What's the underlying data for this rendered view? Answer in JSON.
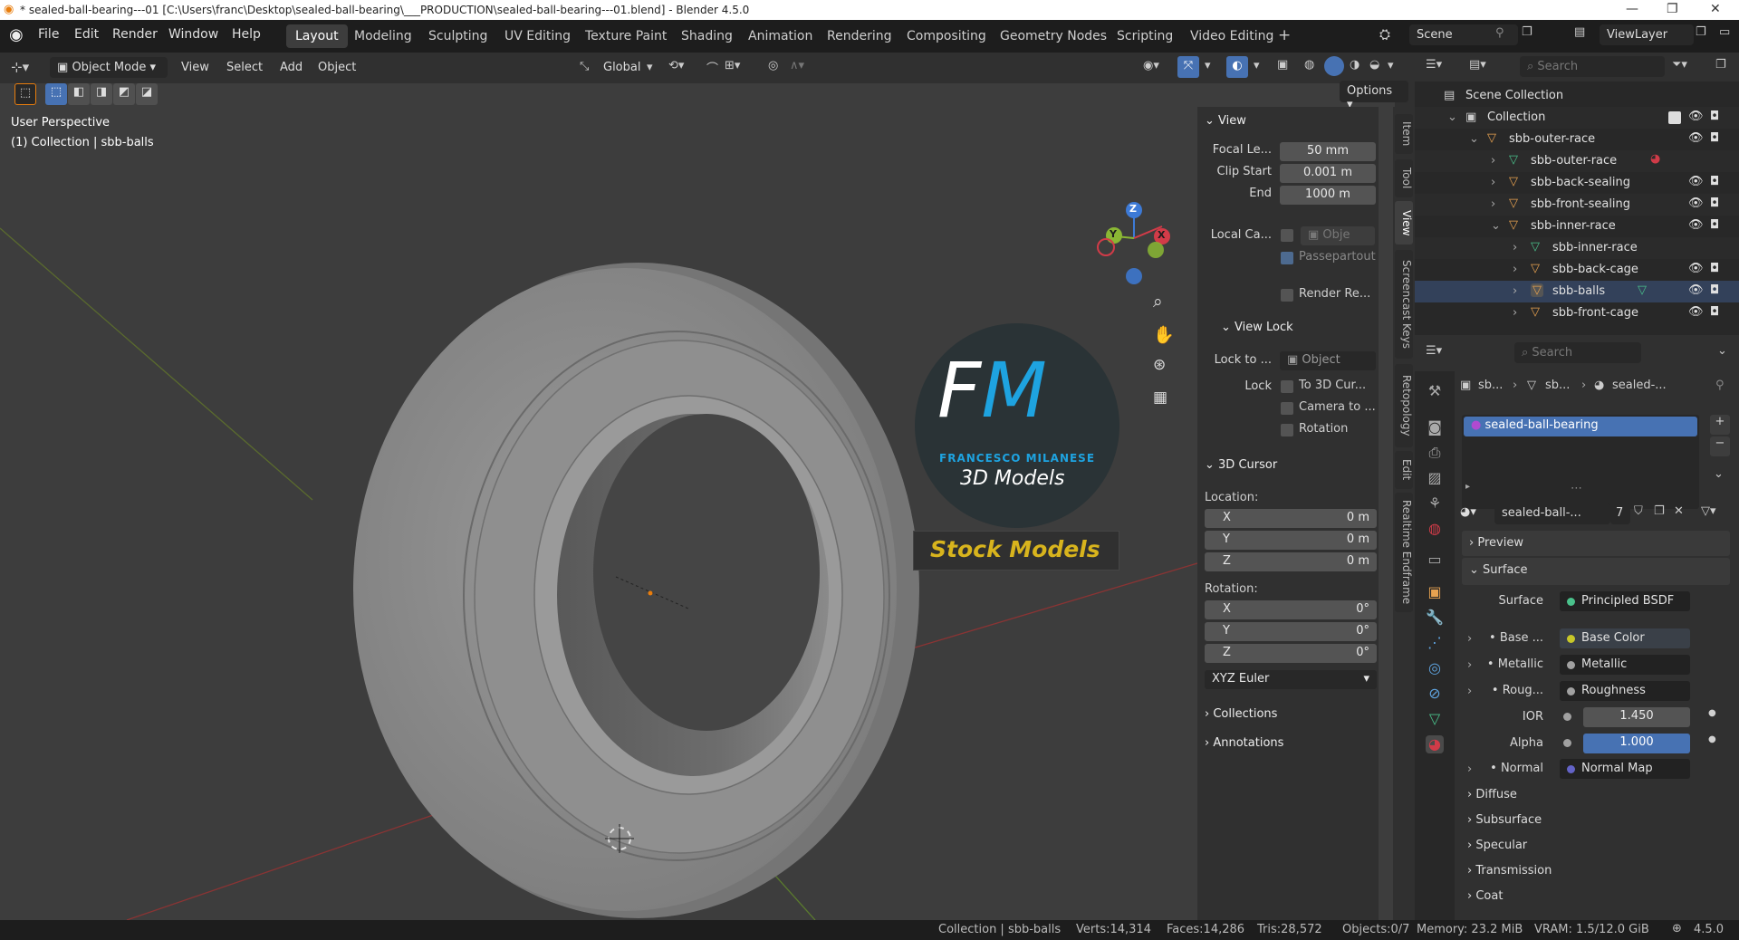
{
  "window": {
    "title": "* sealed-ball-bearing---01 [C:\\Users\\franc\\Desktop\\sealed-ball-bearing\\___PRODUCTION\\sealed-ball-bearing---01.blend] - Blender 4.5.0"
  },
  "menu": [
    "File",
    "Edit",
    "Render",
    "Window",
    "Help"
  ],
  "workspaces": [
    "Layout",
    "Modeling",
    "Sculpting",
    "UV Editing",
    "Texture Paint",
    "Shading",
    "Animation",
    "Rendering",
    "Compositing",
    "Geometry Nodes",
    "Scripting",
    "Video Editing"
  ],
  "active_workspace": "Layout",
  "scene": {
    "name": "Scene",
    "view_layer": "ViewLayer"
  },
  "viewport_header": {
    "mode": "Object Mode",
    "menus": [
      "View",
      "Select",
      "Add",
      "Object"
    ],
    "orientation": "Global",
    "options_label": "Options"
  },
  "viewport": {
    "perspective": "User Perspective",
    "collection_info": "(1) Collection | sbb-balls",
    "gizmo_axes": [
      "Z",
      "Y",
      "X"
    ]
  },
  "watermark": {
    "logo": "FM",
    "name": "FRANCESCO MILANESE",
    "subtitle": "3D Models",
    "stock": "Stock Models"
  },
  "npanel": {
    "view_header": "View",
    "focal_label": "Focal Le...",
    "focal": "50 mm",
    "clip_start_label": "Clip Start",
    "clip_start": "0.001 m",
    "end_label": "End",
    "end": "1000 m",
    "local_cam_label": "Local Ca...",
    "local_cam_value": "Obje",
    "passepartout": "Passepartout",
    "render_region": "Render Re...",
    "view_lock_header": "View Lock",
    "lock_to_label": "Lock to ...",
    "lock_to_value": "Object",
    "lock_label": "Lock",
    "lock_cursor": "To 3D Cur...",
    "lock_camera": "Camera to ...",
    "lock_rotation": "Rotation",
    "cursor_header": "3D Cursor",
    "location_label": "Location:",
    "rotation_label": "Rotation:",
    "loc": [
      {
        "axis": "X",
        "value": "0 m"
      },
      {
        "axis": "Y",
        "value": "0 m"
      },
      {
        "axis": "Z",
        "value": "0 m"
      }
    ],
    "rot": [
      {
        "axis": "X",
        "value": "0°"
      },
      {
        "axis": "Y",
        "value": "0°"
      },
      {
        "axis": "Z",
        "value": "0°"
      }
    ],
    "rot_mode": "XYZ Euler",
    "collections": "Collections",
    "annotations": "Annotations"
  },
  "sidebar_tabs": [
    "Item",
    "Tool",
    "View",
    "Screencast Keys",
    "Retopology",
    "Edit",
    "Realtime Endframe"
  ],
  "active_sidebar_tab": "View",
  "outliner": {
    "search_placeholder": "Search",
    "rows": [
      {
        "label": "Scene Collection",
        "indent": 0
      },
      {
        "label": "Collection",
        "indent": 1
      },
      {
        "label": "sbb-outer-race",
        "indent": 2
      },
      {
        "label": "sbb-outer-race",
        "indent": 3
      },
      {
        "label": "sbb-back-sealing",
        "indent": 3
      },
      {
        "label": "sbb-front-sealing",
        "indent": 3
      },
      {
        "label": "sbb-inner-race",
        "indent": 3
      },
      {
        "label": "sbb-inner-race",
        "indent": 4
      },
      {
        "label": "sbb-back-cage",
        "indent": 4
      },
      {
        "label": "sbb-balls",
        "indent": 4
      },
      {
        "label": "sbb-front-cage",
        "indent": 4
      }
    ]
  },
  "properties": {
    "search_placeholder": "Search",
    "breadcrumb": [
      "sb...",
      "sb...",
      "sealed-..."
    ],
    "material_slot": "sealed-ball-bearing",
    "material_name": "sealed-ball-...",
    "users": "7",
    "preview": "Preview",
    "surface_header": "Surface",
    "surface_label": "Surface",
    "surface_value": "Principled BSDF",
    "rows": [
      {
        "label": "Base ...",
        "value": "Base Color",
        "dot": "#c7c729"
      },
      {
        "label": "Metallic",
        "value": "Metallic",
        "dot": "#a1a1a1"
      },
      {
        "label": "Roug...",
        "value": "Roughness",
        "dot": "#a1a1a1"
      }
    ],
    "ior_label": "IOR",
    "ior": "1.450",
    "alpha_label": "Alpha",
    "alpha": "1.000",
    "normal_label": "Normal",
    "normal_value": "Normal Map",
    "subpanels": [
      "Diffuse",
      "Subsurface",
      "Specular",
      "Transmission",
      "Coat"
    ]
  },
  "status": {
    "collection": "Collection | sbb-balls",
    "verts": "Verts:14,314",
    "faces": "Faces:14,286",
    "tris": "Tris:28,572",
    "objects": "Objects:0/7",
    "memory": "Memory: 23.2 MiB",
    "vram": "VRAM: 1.5/12.0 GiB",
    "version": "4.5.0"
  },
  "colors": {
    "accent": "#4772b3",
    "alpha_bar": "#4772b3",
    "mesh_icon": "#e8a250",
    "data_icon": "#4ac18b"
  }
}
